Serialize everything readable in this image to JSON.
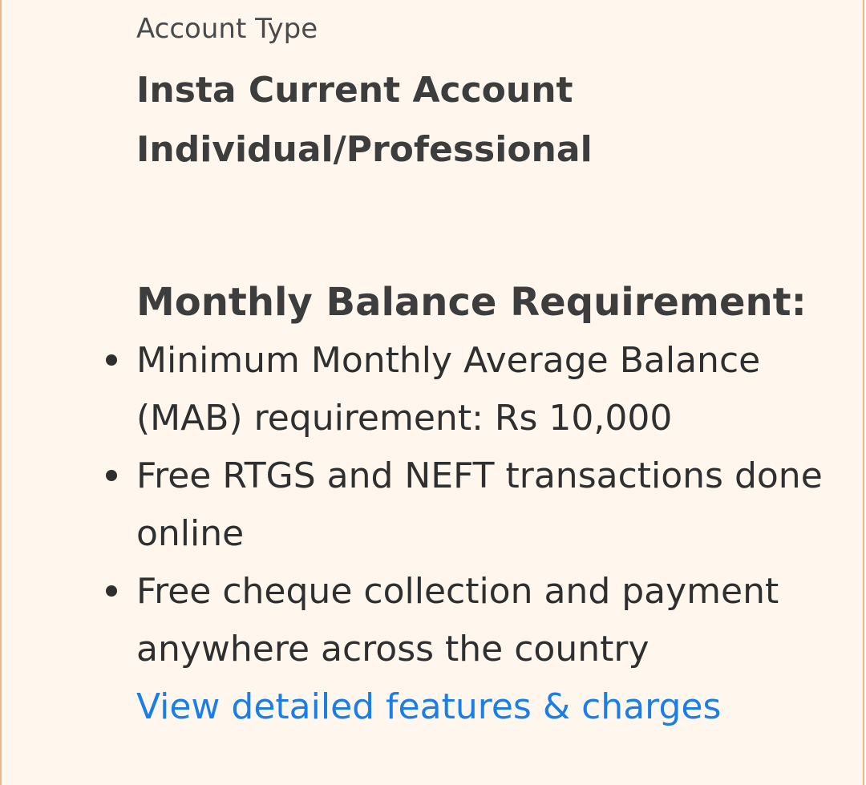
{
  "account": {
    "label": "Account Type",
    "name": "Insta Current Account Individual/Professional"
  },
  "balance": {
    "title": "Monthly Balance Requirement:",
    "items": [
      "Minimum Monthly Average Balance (MAB) requirement: Rs 10,000",
      "Free RTGS and NEFT transactions done online",
      "Free cheque collection and payment anywhere across the country"
    ]
  },
  "link": {
    "label": "View detailed features & charges"
  },
  "colors": {
    "background": "#fff7ee",
    "border": "#e8b98a",
    "link": "#1a7ee6",
    "text": "#3d3d3d"
  }
}
